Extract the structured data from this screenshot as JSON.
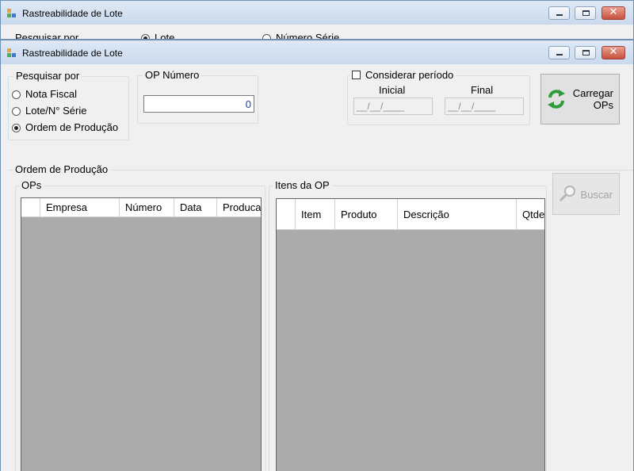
{
  "back_window": {
    "title": "Rastreabilidade de Lote",
    "peek_search_label": "Pesquisar por",
    "peek_radio_lote": "Lote",
    "peek_radio_numero_serie": "Número Série"
  },
  "window": {
    "title": "Rastreabilidade de Lote",
    "controls": {
      "minimize": "▭",
      "maximize": "□",
      "close": "✕"
    }
  },
  "pesquisar_por": {
    "label": "Pesquisar por",
    "options": [
      {
        "label": "Nota Fiscal",
        "selected": false
      },
      {
        "label": "Lote/N° Série",
        "selected": false
      },
      {
        "label": "Ordem de Produção",
        "selected": true
      }
    ]
  },
  "op_numero": {
    "label": "OP Número",
    "value": "0"
  },
  "periodo": {
    "checkbox_label": "Considerar período",
    "checked": false,
    "inicial_label": "Inicial",
    "final_label": "Final",
    "inicial_value": "__/__/____",
    "final_value": "__/__/____"
  },
  "carregar_button": {
    "line1": "Carregar",
    "line2": "OPs",
    "icon": "refresh-arrows-icon"
  },
  "ordem_producao": {
    "label": "Ordem de Produção"
  },
  "ops": {
    "label": "OPs",
    "columns": [
      "Empresa",
      "Número",
      "Data",
      "Produca"
    ]
  },
  "itens_op": {
    "label": "Itens da OP",
    "columns": [
      "Item",
      "Produto",
      "Descrição",
      "Qtde."
    ]
  },
  "buscar_button": {
    "label": "Buscar",
    "icon": "magnifier-icon",
    "enabled": false
  },
  "colors": {
    "window_bg": "#f0f0f0",
    "grid_bg": "#ababab",
    "titlebar": "#c9d9ec",
    "close_button": "#c7503c",
    "accent_green": "#2e9a3a",
    "op_value_text": "#1a3ea8"
  }
}
